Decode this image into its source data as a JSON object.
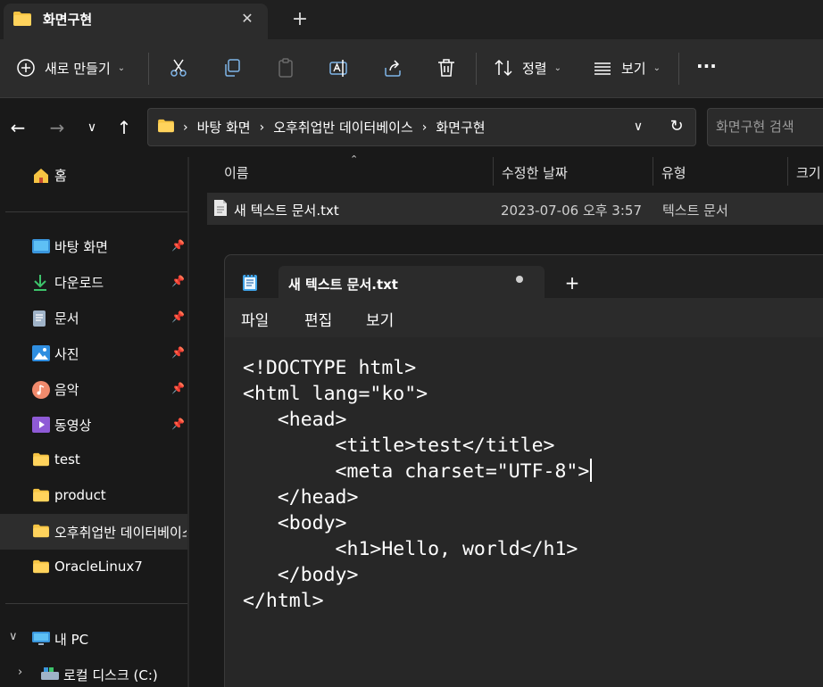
{
  "explorer": {
    "tab_title": "화면구현",
    "tab_close": "✕",
    "new_tab": "+",
    "toolbar": {
      "new_label": "새로 만들기",
      "sort_label": "정렬",
      "view_label": "보기",
      "more": "···"
    },
    "breadcrumbs": [
      "바탕 화면",
      "오후취업반 데이터베이스",
      "화면구현"
    ],
    "search_placeholder": "화면구현 검색",
    "sidebar": {
      "home": "홈",
      "pinned": [
        "바탕 화면",
        "다운로드",
        "문서",
        "사진",
        "음악",
        "동영상"
      ],
      "folders": [
        "test",
        "product",
        "오후취업반 데이터베이스",
        "OracleLinux7"
      ],
      "this_pc": "내 PC",
      "local_disk": "로컬 디스크 (C:)"
    },
    "columns": [
      "이름",
      "수정한 날짜",
      "유형",
      "크기"
    ],
    "files": [
      {
        "name": "새 텍스트 문서.txt",
        "modified": "2023-07-06 오후 3:57",
        "type": "텍스트 문서"
      }
    ]
  },
  "notepad": {
    "tab_title": "새 텍스트 문서.txt",
    "plus": "+",
    "menu": [
      "파일",
      "편집",
      "보기"
    ],
    "lines": [
      "<!DOCTYPE html>",
      "<html lang=\"ko\">",
      "   <head>",
      "        <title>test</title>",
      "        <meta charset=\"UTF-8\">",
      "   </head>",
      "   <body>",
      "        <h1>Hello, world</h1>",
      "   </body>",
      "</html>"
    ]
  },
  "colors": {
    "background": "#191919",
    "panel": "#2c2c2c",
    "selected": "#2d2d2d",
    "folder": "#f6c443",
    "text": "#ffffff"
  }
}
